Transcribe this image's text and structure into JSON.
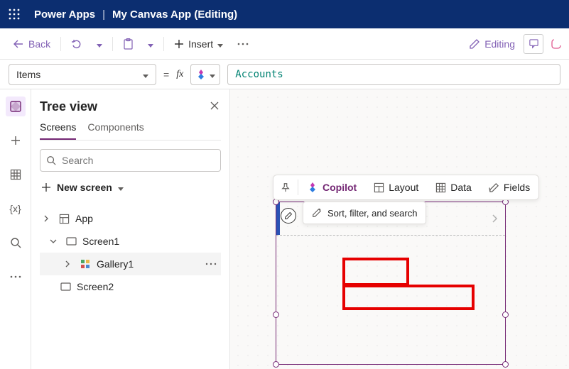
{
  "titlebar": {
    "product": "Power Apps",
    "separator": "|",
    "doc": "My Canvas App (Editing)"
  },
  "cmdbar": {
    "back": "Back",
    "insert": "Insert",
    "editing": "Editing"
  },
  "fxbar": {
    "property": "Items",
    "equals": "=",
    "fx": "fx",
    "value": "Accounts"
  },
  "tree": {
    "title": "Tree view",
    "tab_screens": "Screens",
    "tab_components": "Components",
    "search_placeholder": "Search",
    "new_screen": "New screen",
    "items": {
      "app": "App",
      "screen1": "Screen1",
      "gallery1": "Gallery1",
      "screen2": "Screen2"
    }
  },
  "pill": {
    "copilot": "Copilot",
    "layout": "Layout",
    "data": "Data",
    "fields": "Fields",
    "sort": "Sort, filter, and search"
  }
}
